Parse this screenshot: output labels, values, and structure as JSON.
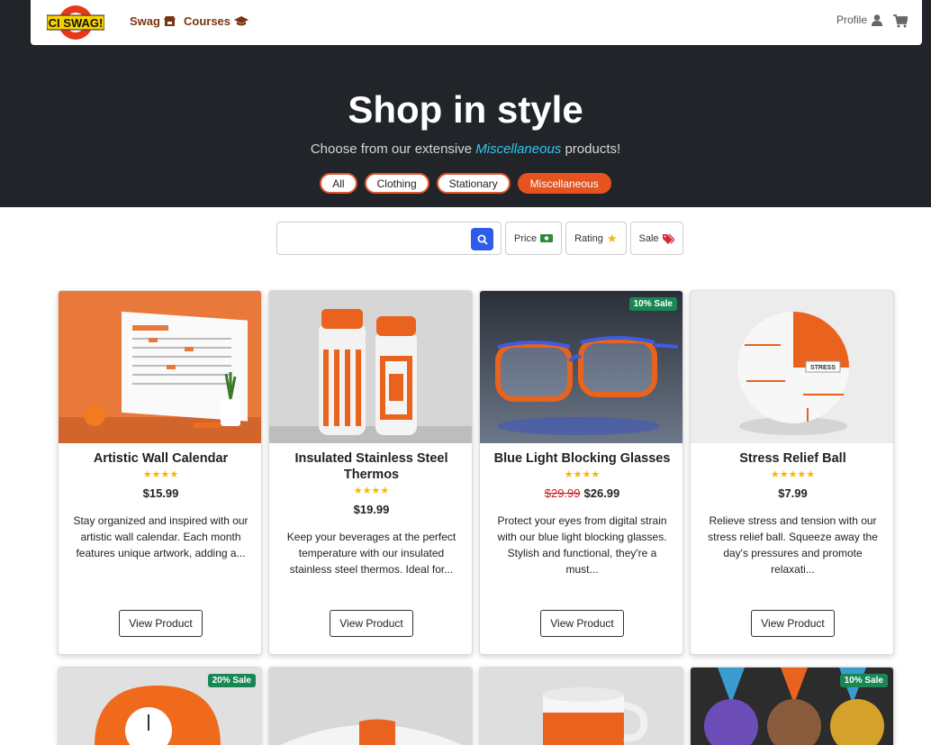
{
  "nav": {
    "logo_text": "CI SWAG!",
    "swag": "Swag",
    "courses": "Courses",
    "profile": "Profile"
  },
  "hero": {
    "title": "Shop in style",
    "subtitle_pre": "Choose from our extensive ",
    "subtitle_em": "Miscellaneous",
    "subtitle_post": " products!",
    "pills": [
      "All",
      "Clothing",
      "Stationary",
      "Miscellaneous"
    ],
    "active_pill": "Miscellaneous"
  },
  "filters": {
    "search_value": "",
    "price": "Price",
    "rating": "Rating",
    "sale": "Sale"
  },
  "products": [
    {
      "title": "Artistic Wall Calendar",
      "stars": "★★★★",
      "price": "$15.99",
      "old_price": "",
      "desc": "Stay organized and inspired with our artistic wall calendar. Each month features unique artwork, adding a...",
      "button": "View Product",
      "sale": ""
    },
    {
      "title": "Insulated Stainless Steel Thermos",
      "stars": "★★★★",
      "price": "$19.99",
      "old_price": "",
      "desc": "Keep your beverages at the perfect temperature with our insulated stainless steel thermos. Ideal for...",
      "button": "View Product",
      "sale": ""
    },
    {
      "title": "Blue Light Blocking Glasses",
      "stars": "★★★★",
      "price": "$26.99",
      "old_price": "$29.99",
      "desc": "Protect your eyes from digital strain with our blue light blocking glasses. Stylish and functional, they're a must...",
      "button": "View Product",
      "sale": "10% Sale"
    },
    {
      "title": "Stress Relief Ball",
      "stars": "★★★★★",
      "price": "$7.99",
      "old_price": "",
      "desc": "Relieve stress and tension with our stress relief ball. Squeeze away the day's pressures and promote relaxati...",
      "button": "View Product",
      "sale": ""
    }
  ],
  "row2_sales": [
    "20% Sale",
    "",
    "",
    "10% Sale"
  ],
  "colors": {
    "accent": "#e6531f",
    "dark_bg": "#212529",
    "sale_badge": "#198754",
    "search_btn": "#2f5be8",
    "star": "#f5b800"
  }
}
